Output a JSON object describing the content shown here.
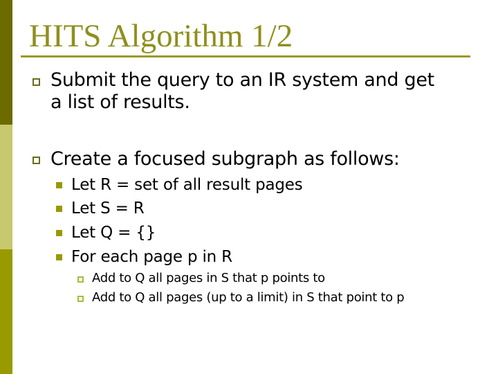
{
  "slide": {
    "title": "HITS Algorithm 1/2",
    "colors": {
      "title": "#8f8f1e",
      "sidebar_top": "#6b6b00",
      "sidebar_middle": "#c8c86e",
      "sidebar_bottom": "#999900",
      "bullet_level2": "#999900"
    },
    "bullets": [
      {
        "icon": "hollow-square-bullet",
        "lines": [
          "Submit the query to an IR system and get",
          "a list of results."
        ]
      },
      {
        "icon": "hollow-square-bullet",
        "text": "Create a focused subgraph as follows:",
        "children": [
          {
            "icon": "filled-square-bullet",
            "text": "Let R = set of all result pages"
          },
          {
            "icon": "filled-square-bullet",
            "text": "Let S = R"
          },
          {
            "icon": "filled-square-bullet",
            "text": "Let Q = {}"
          },
          {
            "icon": "filled-square-bullet",
            "text": "For each page p in R",
            "children": [
              {
                "icon": "small-hollow-square-bullet",
                "text": "Add to Q all pages in S that p points to"
              },
              {
                "icon": "small-hollow-square-bullet",
                "text": "Add to Q all pages (up to a limit) in S that point to p"
              }
            ]
          }
        ]
      }
    ]
  }
}
